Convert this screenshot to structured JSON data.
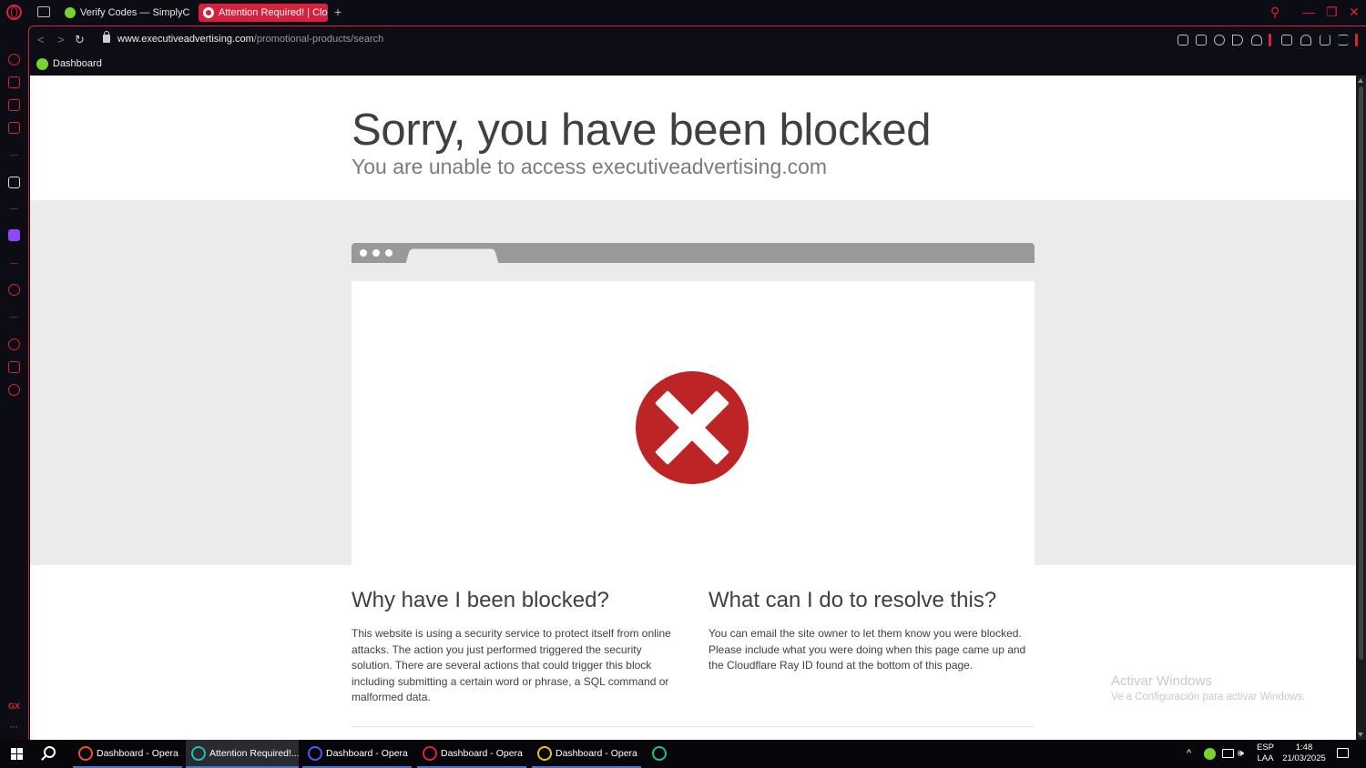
{
  "tabs": [
    {
      "label": "Verify Codes — SimplyCo",
      "active": false
    },
    {
      "label": "Attention Required! | Clou",
      "active": true
    }
  ],
  "address": {
    "host": "www.executiveadvertising.com",
    "path": "/promotional-products/search"
  },
  "bookmarks": [
    {
      "label": "Dashboard"
    }
  ],
  "page": {
    "title": "Sorry, you have been blocked",
    "subtitle": "You are unable to access executiveadvertising.com",
    "why_heading": "Why have I been blocked?",
    "why_text": "This website is using a security service to protect itself from online attacks. The action you just performed triggered the security solution. There are several actions that could trigger this block including submitting a certain word or phrase, a SQL command or malformed data.",
    "resolve_heading": "What can I do to resolve this?",
    "resolve_text": "You can email the site owner to let them know you were blocked. Please include what you were doing when this page came up and the Cloudflare Ray ID found at the bottom of this page."
  },
  "watermark": {
    "title": "Activar Windows",
    "subtitle": "Ve a Configuración para activar Windows."
  },
  "sidebar": {
    "gx_label": "GX",
    "more_label": "···"
  },
  "taskbar": {
    "apps": [
      {
        "label": "Dashboard - Opera",
        "color": "#e8581c",
        "active": false
      },
      {
        "label": "Attention Required!...",
        "color": "#19c3b4",
        "active": true
      },
      {
        "label": "Dashboard - Opera",
        "color": "#4a5cf0",
        "active": false
      },
      {
        "label": "Dashboard - Opera",
        "color": "#e0203a",
        "active": false
      },
      {
        "label": "Dashboard - Opera",
        "color": "#e8c21c",
        "active": false
      }
    ],
    "language": "ESP",
    "layout": "LAA",
    "time": "1:48",
    "date": "21/03/2025"
  },
  "colors": {
    "accent": "#d6213d",
    "block_red": "#bd2426"
  }
}
